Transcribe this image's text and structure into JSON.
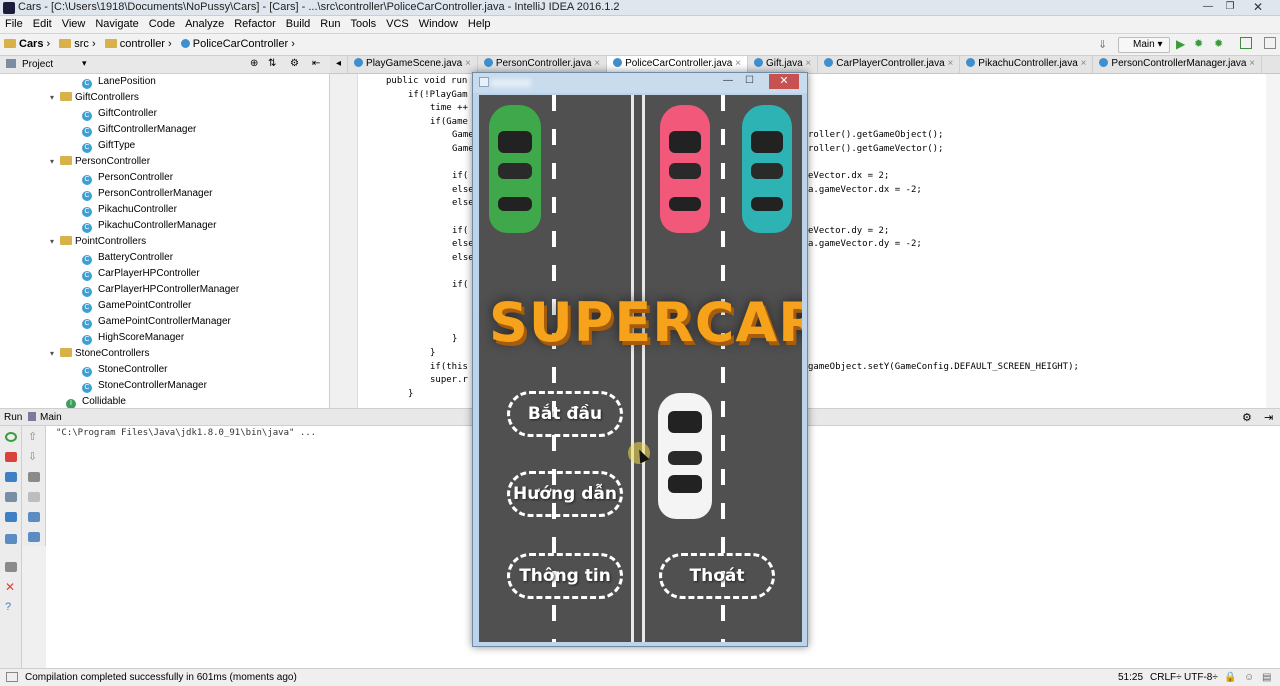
{
  "window": {
    "title": "Cars - [C:\\Users\\1918\\Documents\\NoPussy\\Cars] - [Cars] - ...\\src\\controller\\PoliceCarController.java - IntelliJ IDEA 2016.1.2"
  },
  "menu": [
    "File",
    "Edit",
    "View",
    "Navigate",
    "Code",
    "Analyze",
    "Refactor",
    "Build",
    "Run",
    "Tools",
    "VCS",
    "Window",
    "Help"
  ],
  "breadcrumb": [
    "Cars",
    "src",
    "controller",
    "PoliceCarController"
  ],
  "run_config": "Main",
  "tabs": [
    "PlayGameScene.java",
    "PersonController.java",
    "PoliceCarController.java",
    "Gift.java",
    "CarPlayerController.java",
    "PikachuController.java",
    "PersonControllerManager.java"
  ],
  "active_tab": "PoliceCarController.java",
  "project": {
    "title": "Project",
    "items": [
      {
        "label": "LanePosition",
        "kind": "class",
        "depth": 3
      },
      {
        "label": "GiftControllers",
        "kind": "folder",
        "depth": 2
      },
      {
        "label": "GiftController",
        "kind": "class",
        "depth": 3
      },
      {
        "label": "GiftControllerManager",
        "kind": "class",
        "depth": 3
      },
      {
        "label": "GiftType",
        "kind": "class",
        "depth": 3
      },
      {
        "label": "PersonController",
        "kind": "folder",
        "depth": 2
      },
      {
        "label": "PersonController",
        "kind": "class",
        "depth": 3
      },
      {
        "label": "PersonControllerManager",
        "kind": "class",
        "depth": 3
      },
      {
        "label": "PikachuController",
        "kind": "class",
        "depth": 3
      },
      {
        "label": "PikachuControllerManager",
        "kind": "class",
        "depth": 3
      },
      {
        "label": "PointControllers",
        "kind": "folder",
        "depth": 2
      },
      {
        "label": "BatteryController",
        "kind": "class",
        "depth": 3
      },
      {
        "label": "CarPlayerHPController",
        "kind": "class",
        "depth": 3
      },
      {
        "label": "CarPlayerHPControllerManager",
        "kind": "class",
        "depth": 3
      },
      {
        "label": "GamePointController",
        "kind": "class",
        "depth": 3
      },
      {
        "label": "GamePointControllerManager",
        "kind": "class",
        "depth": 3
      },
      {
        "label": "HighScoreManager",
        "kind": "class",
        "depth": 3
      },
      {
        "label": "StoneControllers",
        "kind": "folder",
        "depth": 2
      },
      {
        "label": "StoneController",
        "kind": "class",
        "depth": 3
      },
      {
        "label": "StoneControllerManager",
        "kind": "class",
        "depth": 3
      },
      {
        "label": "Collidable",
        "kind": "interface",
        "depth": 2
      }
    ]
  },
  "code_left": [
    {
      "text": "public void run",
      "indent": 0
    },
    {
      "text": "if(!PlayGam",
      "indent": 1
    },
    {
      "text": "time ++",
      "indent": 2
    },
    {
      "text": "if(Game",
      "indent": 2
    },
    {
      "text": "Game",
      "indent": 3
    },
    {
      "text": "Game",
      "indent": 3
    },
    {
      "text": "",
      "indent": 0
    },
    {
      "text": "if(",
      "indent": 3
    },
    {
      "text": "else",
      "indent": 3
    },
    {
      "text": "else",
      "indent": 3
    },
    {
      "text": "",
      "indent": 0
    },
    {
      "text": "if(",
      "indent": 3
    },
    {
      "text": "else",
      "indent": 3
    },
    {
      "text": "else",
      "indent": 3
    },
    {
      "text": "",
      "indent": 0
    },
    {
      "text": "if(",
      "indent": 3
    },
    {
      "text": "",
      "indent": 0
    },
    {
      "text": "",
      "indent": 0
    },
    {
      "text": "",
      "indent": 0
    },
    {
      "text": "}",
      "indent": 3
    },
    {
      "text": "}",
      "indent": 2
    },
    {
      "text": "if(this",
      "indent": 2
    },
    {
      "text": "super.r",
      "indent": 2
    },
    {
      "text": "}",
      "indent": 1
    }
  ],
  "code_right": [
    {
      "text": "roller().getGameObject();",
      "line": 4
    },
    {
      "text": "roller().getGameVector();",
      "line": 5
    },
    {
      "text": "eVector.dx = 2;",
      "line": 7
    },
    {
      "text": "a.gameVector.dx = -2;",
      "line": 8
    },
    {
      "text": "eVector.dy = 2;",
      "line": 11
    },
    {
      "text": "a.gameVector.dy = -2;",
      "line": 12
    },
    {
      "text": "gameObject.setY(GameConfig.DEFAULT_SCREEN_HEIGHT);",
      "line": 21
    }
  ],
  "run_panel": {
    "label": "Run",
    "config": "Main",
    "console_line": "\"C:\\Program Files\\Java\\jdk1.8.0_91\\bin\\java\" ..."
  },
  "status": {
    "message": "Compilation completed successfully in 601ms (moments ago)",
    "position": "51:25",
    "line_sep": "CRLF÷",
    "encoding": "UTF-8÷"
  },
  "game": {
    "logo": "SUPERCAR",
    "buttons": {
      "start": "Bắt đầu",
      "help": "Hướng dẫn",
      "info": "Thông tin",
      "exit": "Thoát"
    },
    "colors": {
      "green": "#3fa84a",
      "pink": "#f2587a",
      "teal": "#2eb3b5",
      "white": "#f4f4f4",
      "road": "#505050",
      "logo": "#f6a21a"
    }
  }
}
